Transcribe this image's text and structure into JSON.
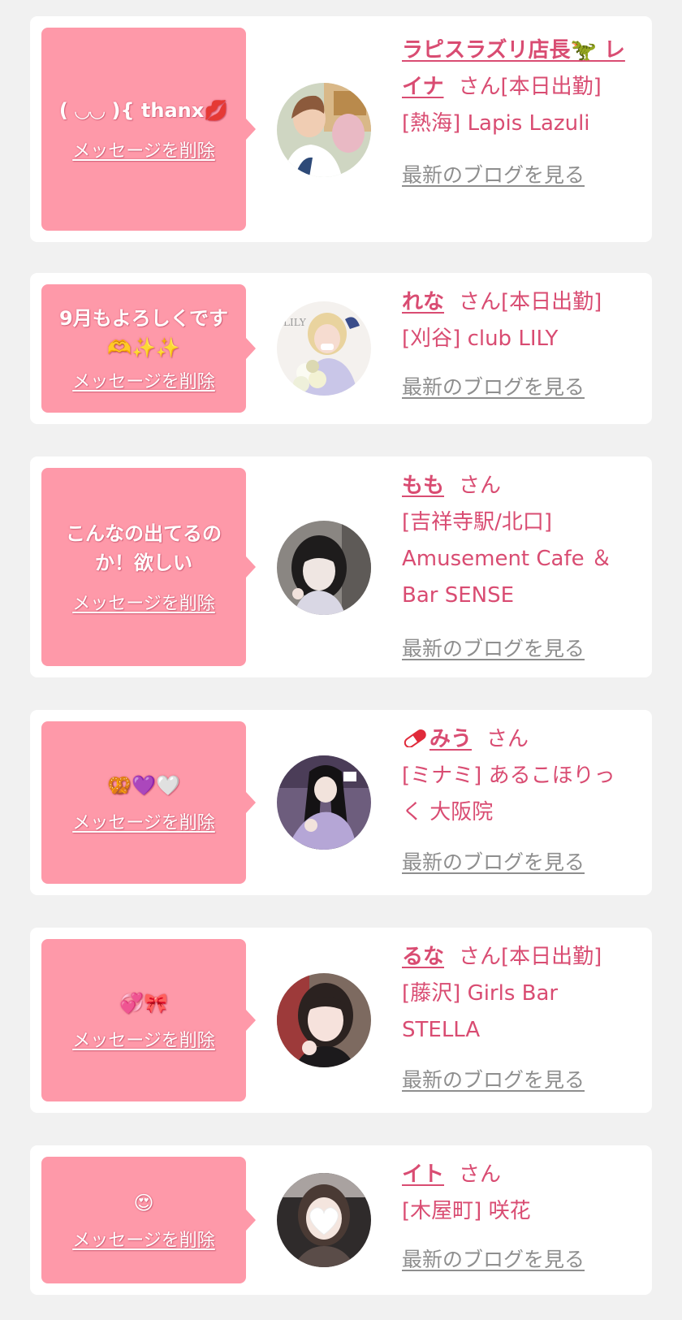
{
  "delete_label": "メッセージを削除",
  "blog_label": "最新のブログを見る",
  "colors": {
    "background": "#f1f1f1",
    "card": "#ffffff",
    "bubble": "#fe99a9",
    "name": "#d94c72",
    "blog_link": "#8e8e8e"
  },
  "cards": [
    {
      "message": "( ◡◡ ){ thanx",
      "message_emoji": "💋",
      "name": "ラピスラズリ店長🦖 レイナ",
      "san": "さん",
      "status": "[本日出勤]",
      "area": "[熱海]",
      "shop": "Lapis Lazuli",
      "avatar_icon": "avatar-photo-icon"
    },
    {
      "message": "9月もよろしくです",
      "message_emoji": "🫶✨✨",
      "name": "れな",
      "san": "さん",
      "status": "[本日出勤]",
      "area": "[刈谷]",
      "shop": "club LILY",
      "avatar_icon": "avatar-photo-icon"
    },
    {
      "message": "こんなの出てるのか！欲しい",
      "message_emoji": "",
      "name": "もも",
      "san": "さん",
      "status": "",
      "area": "[吉祥寺駅/北口]",
      "shop": "Amusement Cafe ＆Bar SENSE",
      "avatar_icon": "avatar-photo-icon"
    },
    {
      "message": "",
      "message_emoji": "🥨💜🤍",
      "name": "みう",
      "name_prefix_icon": "pill-icon",
      "san": "さん",
      "status": "",
      "area": "[ミナミ]",
      "shop": "あるこほりっく 大阪院",
      "avatar_icon": "avatar-photo-icon"
    },
    {
      "message": "",
      "message_emoji": "💞🎀",
      "name": "るな",
      "san": "さん",
      "status": "[本日出勤]",
      "area": "[藤沢]",
      "shop": "Girls Bar STELLA",
      "avatar_icon": "avatar-photo-icon"
    },
    {
      "message": "",
      "message_emoji": "😍",
      "name": "イト",
      "san": "さん",
      "status": "",
      "area": "[木屋町]",
      "shop": "咲花",
      "avatar_icon": "avatar-photo-icon"
    }
  ]
}
